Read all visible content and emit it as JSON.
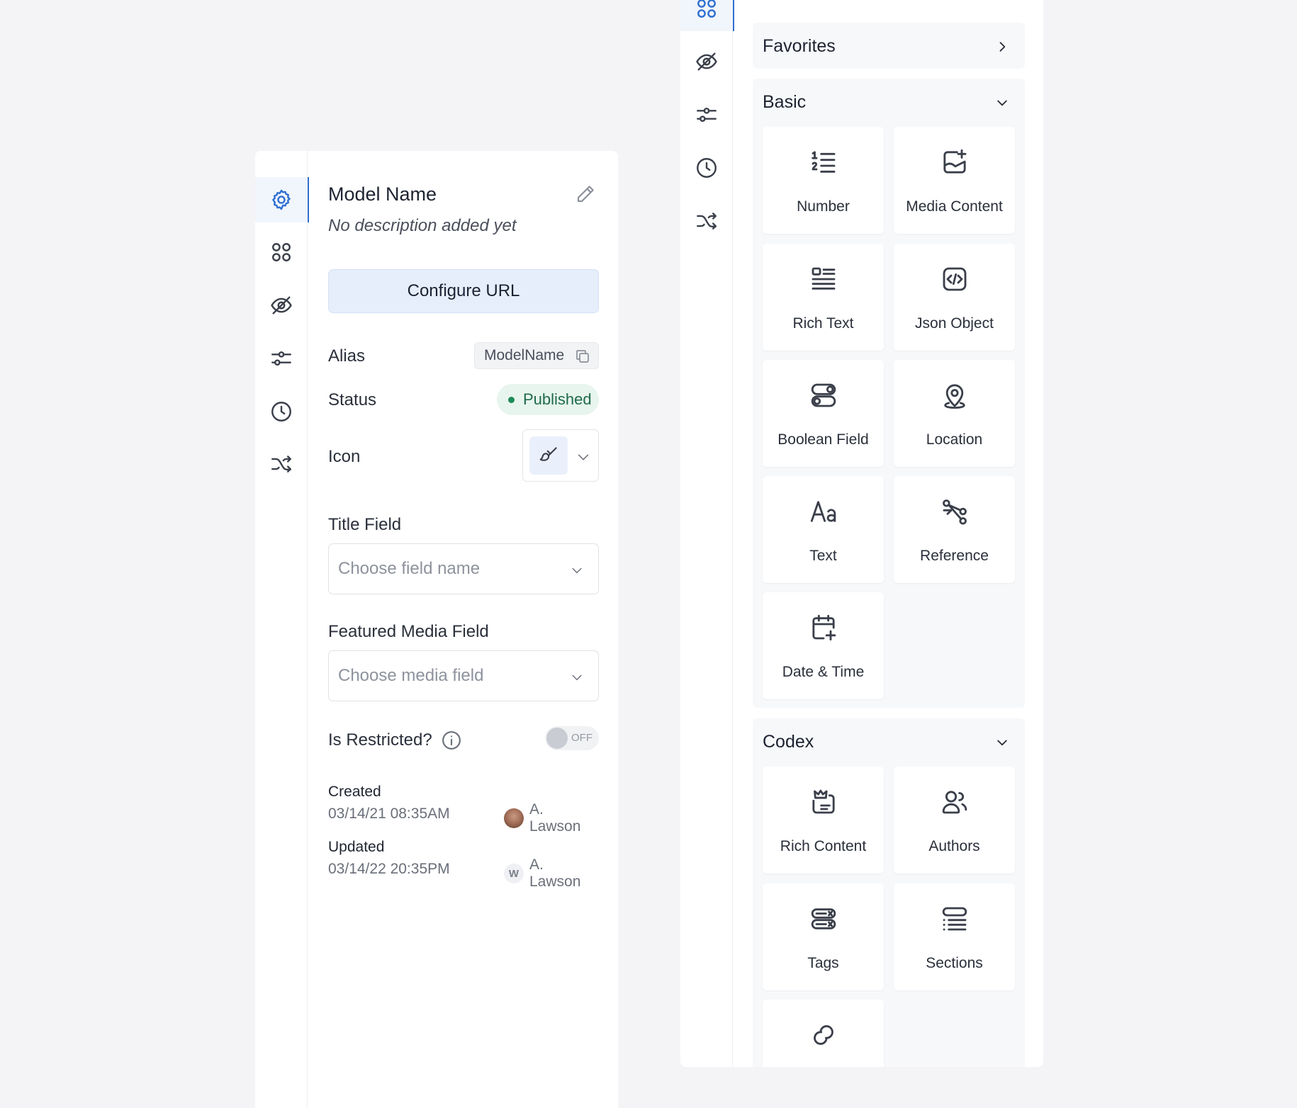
{
  "left_panel": {
    "rail_icons": [
      "gear-icon",
      "grid-icon",
      "eye-off-icon",
      "sliders-icon",
      "clock-icon",
      "shuffle-icon"
    ],
    "model_title": "Model Name",
    "model_description": "No description added yet",
    "configure_url": "Configure URL",
    "alias": {
      "label": "Alias",
      "value": "ModelName"
    },
    "status": {
      "label": "Status",
      "value": "Published"
    },
    "icon_row": {
      "label": "Icon",
      "selected_icon": "brush-icon"
    },
    "title_field": {
      "label": "Title Field",
      "placeholder": "Choose field name"
    },
    "media_field": {
      "label": "Featured Media Field",
      "placeholder": "Choose media field"
    },
    "restricted": {
      "label": "Is Restricted?",
      "toggle_text": "OFF"
    },
    "created": {
      "label": "Created",
      "date": "03/14/21 08:35AM",
      "user": "A. Lawson"
    },
    "updated": {
      "label": "Updated",
      "date": "03/14/22 20:35PM",
      "user_initial": "W",
      "user": "A. Lawson"
    }
  },
  "right_panel": {
    "rail_icons": [
      "grid-icon",
      "eye-off-icon",
      "sliders-icon",
      "clock-icon",
      "shuffle-icon"
    ],
    "favorites": {
      "title": "Favorites"
    },
    "basic": {
      "title": "Basic",
      "items": [
        {
          "label": "Number",
          "icon": "number-list-icon"
        },
        {
          "label": "Media Content",
          "icon": "media-add-icon"
        },
        {
          "label": "Rich Text",
          "icon": "rich-text-icon"
        },
        {
          "label": "Json Object",
          "icon": "code-icon"
        },
        {
          "label": "Boolean Field",
          "icon": "toggle-icon"
        },
        {
          "label": "Location",
          "icon": "location-pin-icon"
        },
        {
          "label": "Text",
          "icon": "text-aa-icon"
        },
        {
          "label": "Reference",
          "icon": "reference-icon"
        },
        {
          "label": "Date & Time",
          "icon": "calendar-add-icon"
        }
      ]
    },
    "codex": {
      "title": "Codex",
      "items": [
        {
          "label": "Rich Content",
          "icon": "crown-doc-icon"
        },
        {
          "label": "Authors",
          "icon": "users-icon"
        },
        {
          "label": "Tags",
          "icon": "tags-icon"
        },
        {
          "label": "Sections",
          "icon": "sections-icon"
        },
        {
          "label": "",
          "icon": "link-icon"
        }
      ]
    }
  }
}
